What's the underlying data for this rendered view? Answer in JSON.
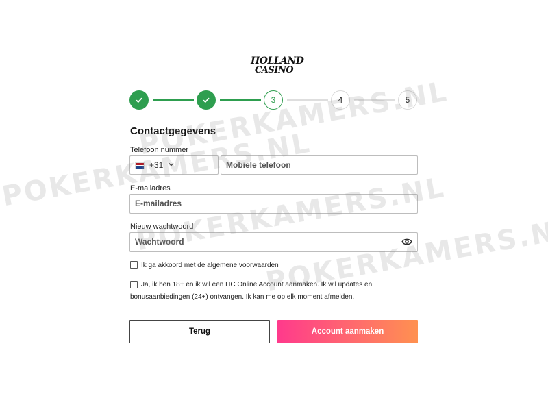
{
  "brand": {
    "line1": "HOLLAND",
    "line2": "CASINO"
  },
  "stepper": {
    "steps": [
      {
        "label": "",
        "state": "done",
        "icon": "check-icon"
      },
      {
        "label": "",
        "state": "done",
        "icon": "check-icon"
      },
      {
        "label": "3",
        "state": "current"
      },
      {
        "label": "4",
        "state": "todo"
      },
      {
        "label": "5",
        "state": "todo"
      }
    ],
    "active_color": "#2e9e4f"
  },
  "form": {
    "title": "Contactgegevens",
    "phone": {
      "label": "Telefoon nummer",
      "country_code": "+31",
      "flag_icon": "netherlands-flag-icon",
      "placeholder": "Mobiele telefoon"
    },
    "email": {
      "label": "E-mailadres",
      "placeholder": "E-mailadres"
    },
    "password": {
      "label": "Nieuw wachtwoord",
      "placeholder": "Wachtwoord",
      "toggle_icon": "eye-icon"
    },
    "terms": {
      "text": "Ik ga akkoord met de ",
      "link": "algemene voorwaarden",
      "checked": false
    },
    "consent": {
      "line1": "Ja, ik ben 18+ en ik wil een HC Online Account aanmaken. Ik wil updates en",
      "line2": "bonusaanbiedingen (24+) ontvangen. Ik kan me op elk moment afmelden.",
      "checked": false
    },
    "back_label": "Terug",
    "create_label": "Account aanmaken"
  },
  "watermark": "POKERKAMERS.NL",
  "colors": {
    "primary_gradient_start": "#ff3a8c",
    "primary_gradient_end": "#ff9150",
    "success": "#2e9e4f"
  }
}
